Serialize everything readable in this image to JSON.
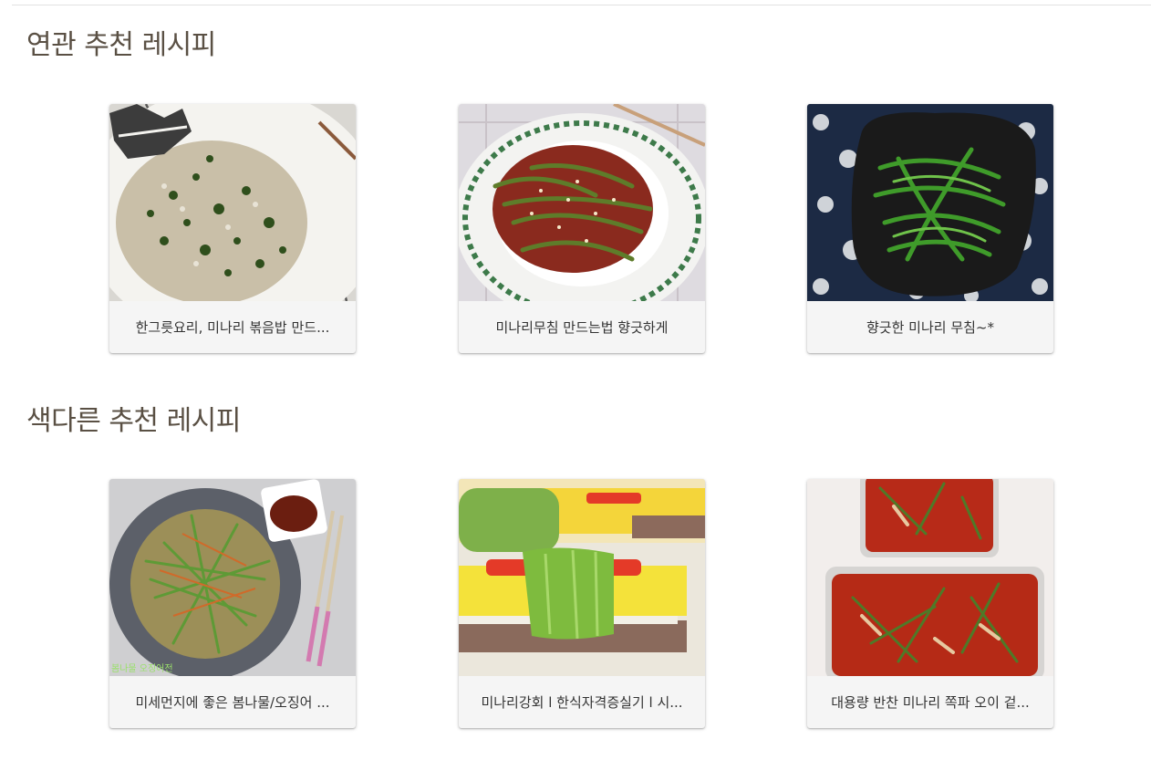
{
  "sections": [
    {
      "title": "연관 추천 레시피",
      "cards": [
        {
          "caption": "한그릇요리, 미나리 볶음밥 만드...",
          "image": "minari-fried-rice-photo"
        },
        {
          "caption": "미나리무침 만드는법 향긋하게",
          "image": "seasoned-minari-red-photo"
        },
        {
          "caption": "향긋한 미나리 무침~*",
          "image": "seasoned-minari-green-photo"
        }
      ]
    },
    {
      "title": "색다른 추천 레시피",
      "cards": [
        {
          "caption": "미세먼지에 좋은 봄나물/오징어 ...",
          "image": "spring-greens-pancake-photo",
          "watermark": "봄나물 오징어전"
        },
        {
          "caption": "미나리강회 l 한식자격증실기 l 시...",
          "image": "minari-ganghoe-photo"
        },
        {
          "caption": "대용량 반찬 미나리 쪽파 오이 겉...",
          "image": "minari-kimchi-photo"
        }
      ]
    }
  ]
}
